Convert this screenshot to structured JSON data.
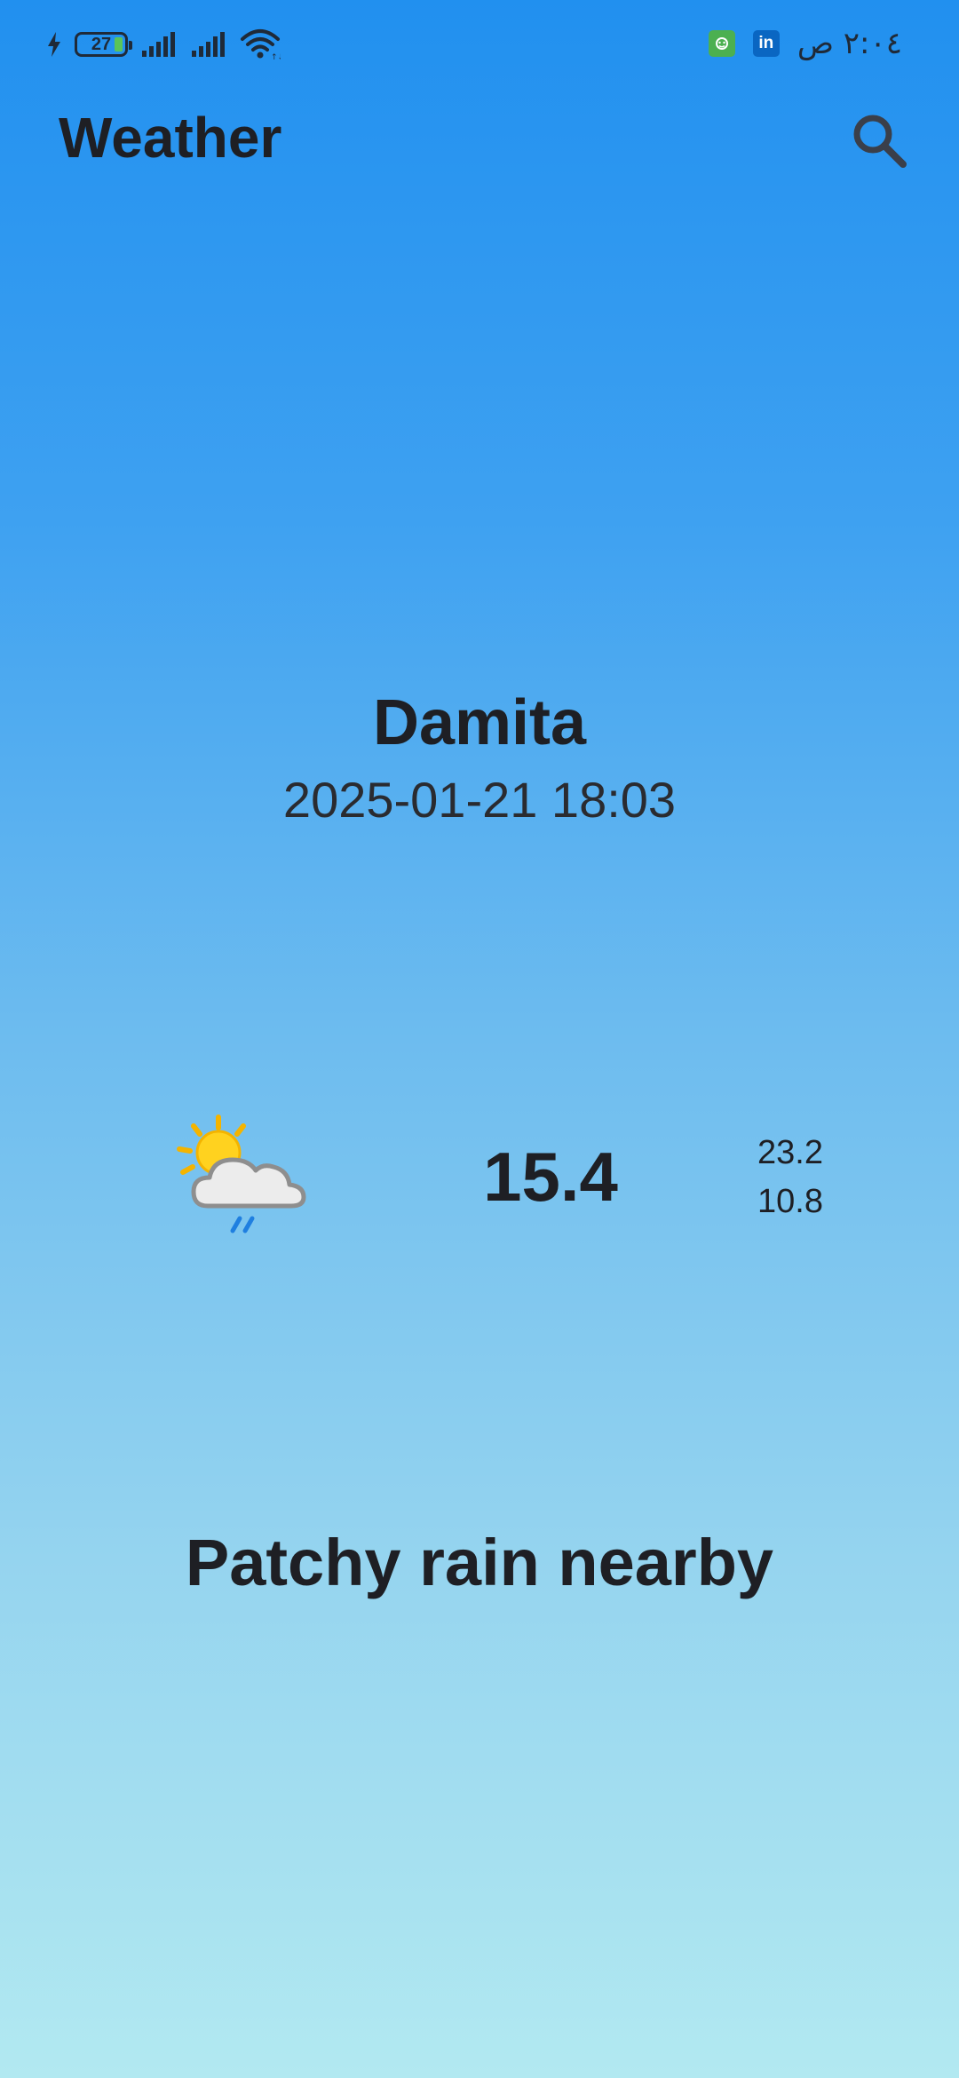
{
  "status_bar": {
    "battery_level": "27",
    "time": "٢:٠٤ ص",
    "notification_icons": [
      "green-app-icon",
      "linkedin-icon"
    ],
    "linkedin_label": "in"
  },
  "app_bar": {
    "title": "Weather",
    "search_icon": "search-icon"
  },
  "location": {
    "city": "Damita",
    "datetime": "2025-01-21 18:03"
  },
  "current": {
    "icon": "patchy-rain-icon",
    "temperature": "15.4",
    "max_temp": "23.2",
    "min_temp": "10.8",
    "condition": "Patchy rain nearby"
  },
  "colors": {
    "gradient_top": "#2190ef",
    "gradient_bottom": "#b2e9f1",
    "text": "#1e1f24",
    "icon_gray": "#3a3f4a"
  }
}
